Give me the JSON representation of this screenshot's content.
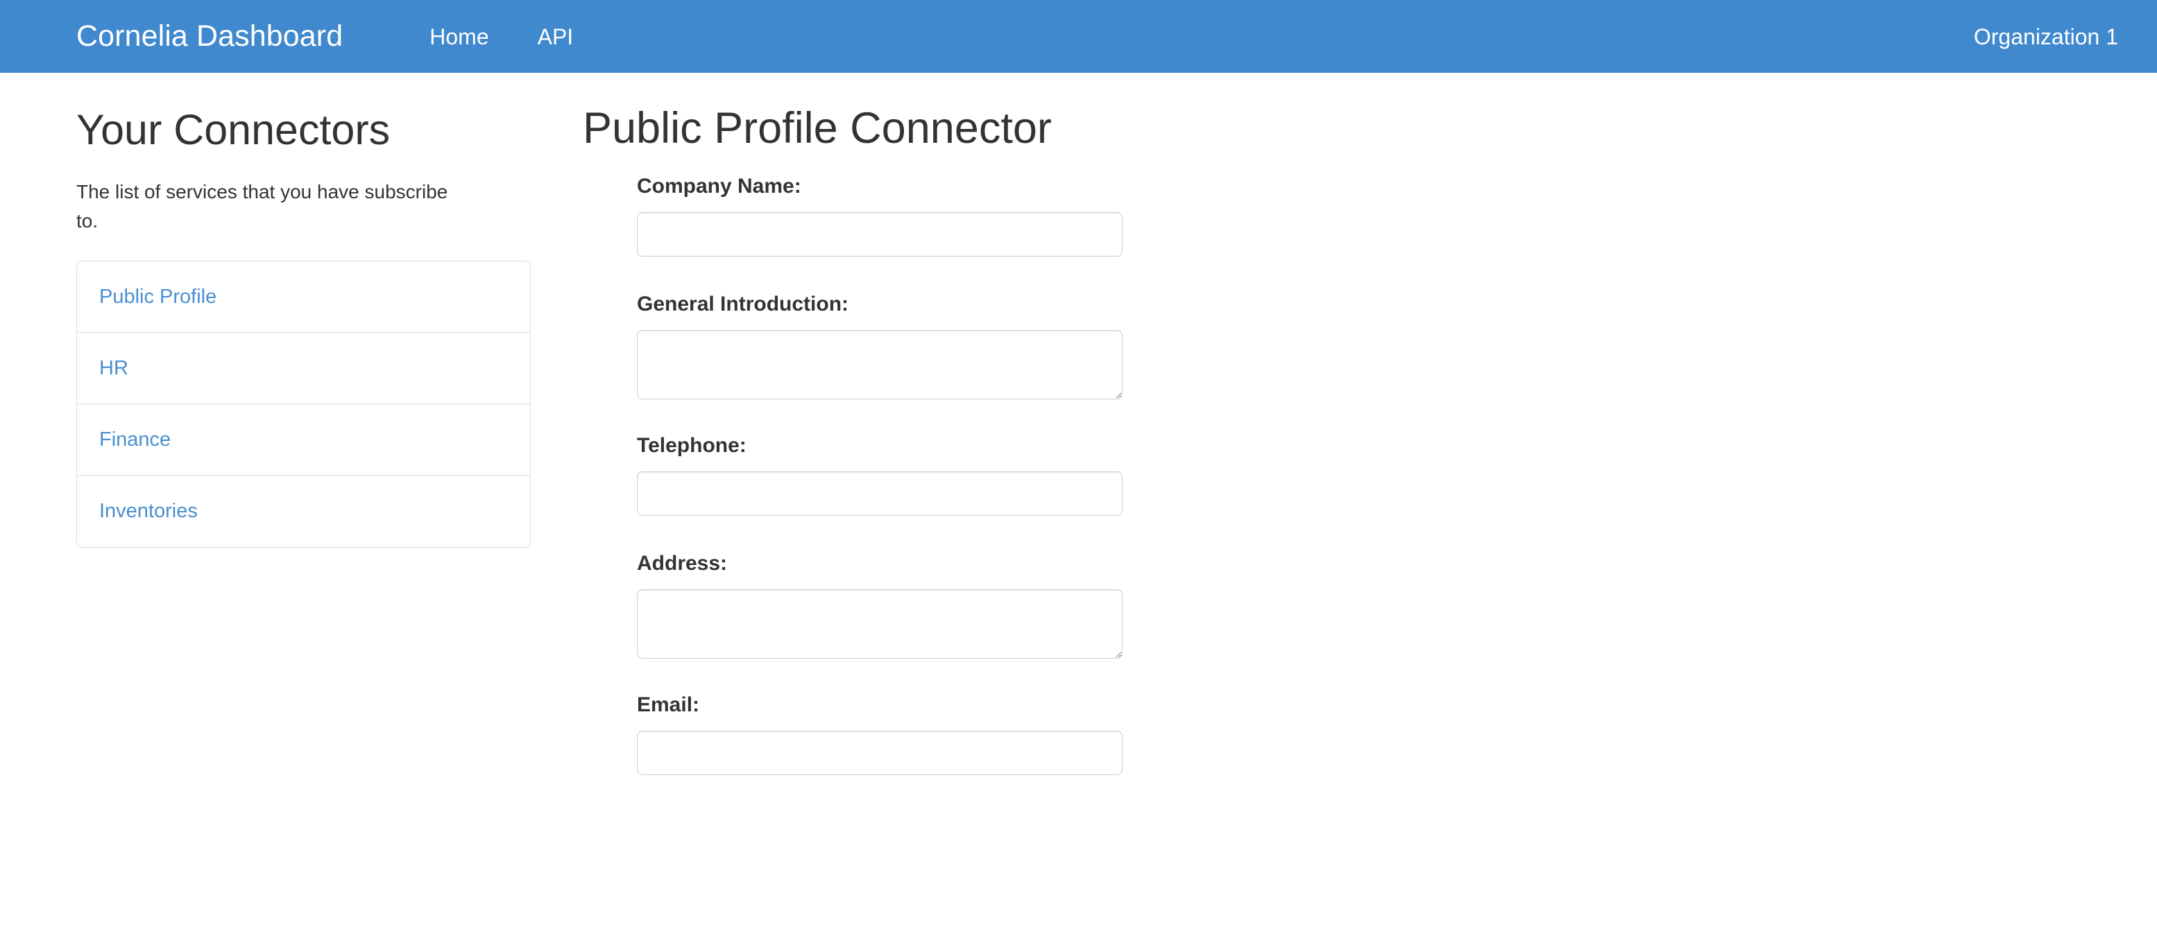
{
  "navbar": {
    "brand": "Cornelia Dashboard",
    "links": [
      {
        "label": "Home"
      },
      {
        "label": "API"
      }
    ],
    "right_label": "Organization 1",
    "background_color": "#4189ce",
    "text_color": "#ffffff"
  },
  "sidebar": {
    "heading": "Your Connectors",
    "description": "The list of services that you have subscribe to.",
    "items": [
      {
        "label": "Public Profile"
      },
      {
        "label": "HR"
      },
      {
        "label": "Finance"
      },
      {
        "label": "Inventories"
      }
    ],
    "link_color": "#4a8fd0"
  },
  "main": {
    "heading": "Public Profile Connector",
    "form": {
      "company_name": {
        "label": "Company Name:",
        "value": "",
        "placeholder": ""
      },
      "general_introduction": {
        "label": "General Introduction:",
        "value": "",
        "placeholder": ""
      },
      "telephone": {
        "label": "Telephone:",
        "value": "",
        "placeholder": ""
      },
      "address": {
        "label": "Address:",
        "value": "",
        "placeholder": ""
      },
      "email": {
        "label": "Email:",
        "value": "",
        "placeholder": ""
      }
    }
  }
}
